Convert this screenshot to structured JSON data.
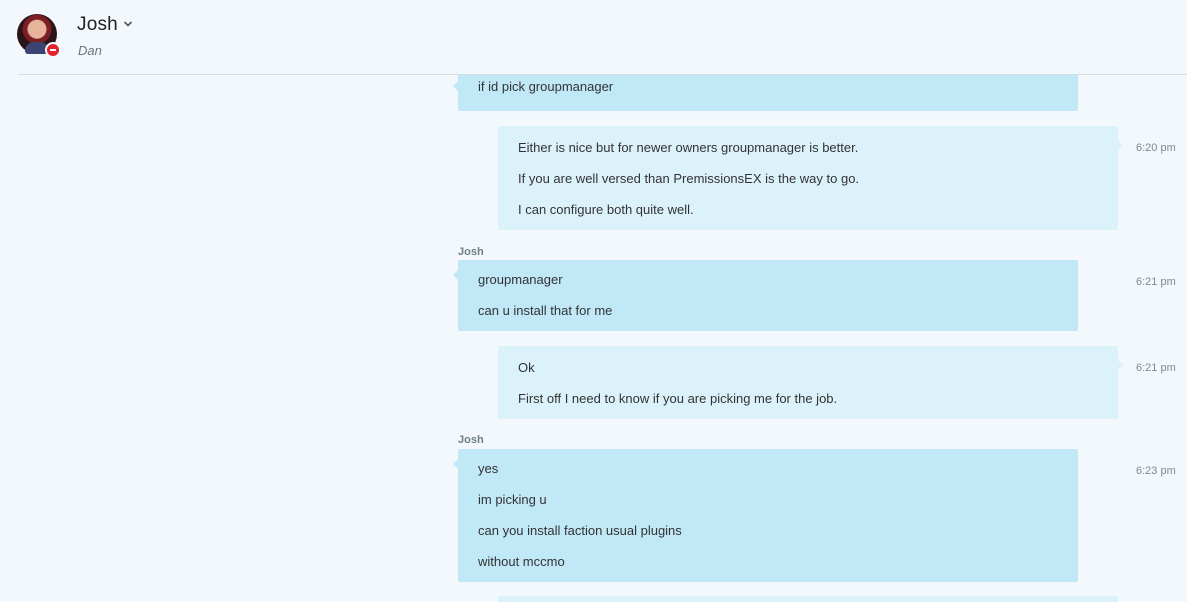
{
  "header": {
    "name": "Josh",
    "subtitle": "Dan",
    "status_color": "#e2222f"
  },
  "messages": [
    {
      "from": "them",
      "sender": "",
      "time": "",
      "lines": [
        "if id pick groupmanager"
      ]
    },
    {
      "from": "me",
      "sender": "",
      "time": "6:20 pm",
      "lines": [
        "Either is nice but for newer owners groupmanager is better.",
        "If you are well versed than PremissionsEX is the way to go.",
        "I can configure both quite well."
      ]
    },
    {
      "from": "them",
      "sender": "Josh",
      "time": "6:21 pm",
      "lines": [
        "groupmanager",
        "can u install that for me"
      ]
    },
    {
      "from": "me",
      "sender": "",
      "time": "6:21 pm",
      "lines": [
        "Ok",
        "First off I need to know if you are picking me for the job."
      ]
    },
    {
      "from": "them",
      "sender": "Josh",
      "time": "6:23 pm",
      "lines": [
        "yes",
        "im picking u",
        "can you install faction usual plugins",
        "without mccmo"
      ]
    },
    {
      "from": "me",
      "sender": "",
      "time": "",
      "lines": []
    }
  ],
  "colors": {
    "background": "#f3f8fc",
    "incoming_bubble": "#c1e8f7",
    "outgoing_bubble": "#dcf2fb"
  }
}
